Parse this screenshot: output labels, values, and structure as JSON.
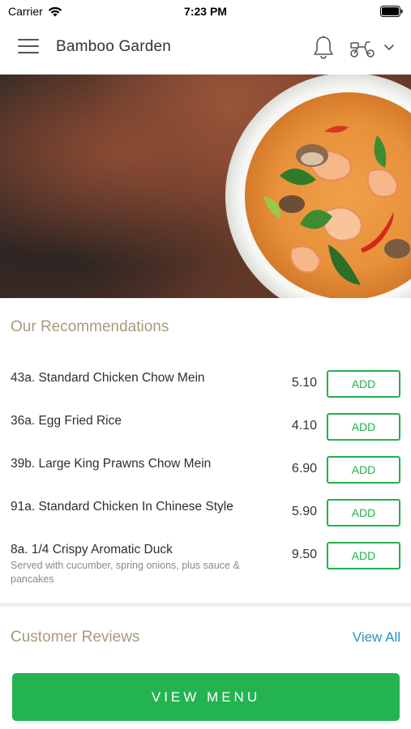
{
  "status_bar": {
    "carrier": "Carrier",
    "time": "7:23 PM"
  },
  "header": {
    "title": "Bamboo Garden",
    "icons": [
      "menu-icon",
      "bell-icon",
      "delivery-scooter-icon",
      "chevron-down-icon"
    ]
  },
  "hero": {
    "image": "tom-yum-soup-photo"
  },
  "recommendations": {
    "title": "Our Recommendations",
    "items": [
      {
        "name": "43a. Standard Chicken Chow Mein",
        "price": "5.10",
        "button": "ADD"
      },
      {
        "name": "36a. Egg Fried Rice",
        "price": "4.10",
        "button": "ADD"
      },
      {
        "name": "39b. Large King Prawns Chow Mein",
        "price": "6.90",
        "button": "ADD"
      },
      {
        "name": "91a. Standard Chicken In Chinese Style",
        "price": "5.90",
        "button": "ADD"
      },
      {
        "name": "8a. 1/4 Crispy Aromatic Duck",
        "description": "Served with cucumber, spring onions, plus sauce & pancakes",
        "price": "9.50",
        "button": "ADD"
      }
    ]
  },
  "reviews": {
    "title": "Customer Reviews",
    "view_all": "View All"
  },
  "view_menu": {
    "label": "VIEW MENU"
  },
  "colors": {
    "accent_green": "#23b451",
    "section_title": "#a99a7c",
    "link_blue": "#2a8fbf"
  }
}
